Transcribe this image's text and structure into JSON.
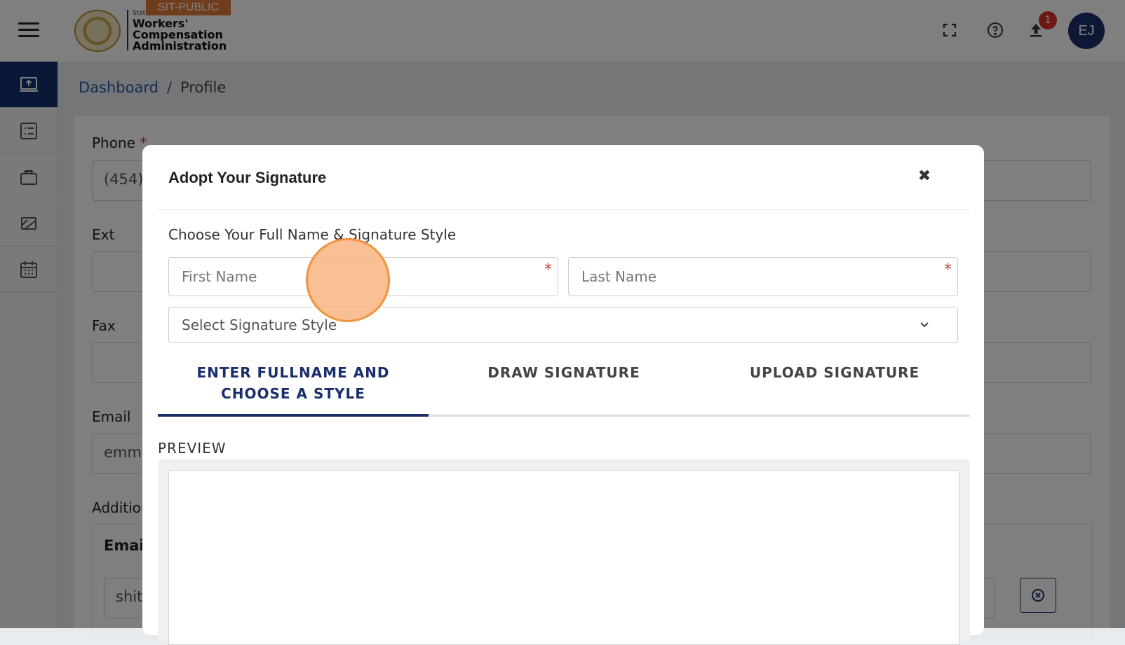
{
  "header": {
    "env_badge": "SIT-PUBLIC",
    "logo_state": "State",
    "logo_line1": "Workers'",
    "logo_line2": "Compensation",
    "logo_line3": "Administration",
    "notification_count": "1",
    "avatar_initials": "EJ"
  },
  "breadcrumb": {
    "home": "Dashboard",
    "separator": "/",
    "current": "Profile"
  },
  "profile_form": {
    "phone_label": "Phone",
    "phone_value": "(454)",
    "ext_label": "Ext",
    "fax_label": "Fax",
    "email_label": "Email",
    "email_value": "emm",
    "additional_label": "Addition",
    "email_table_header": "Emai",
    "email_row_value": "shit",
    "required_mark": "*"
  },
  "modal": {
    "title": "Adopt Your Signature",
    "close_glyph": "✖",
    "choose_label": "Choose Your Full Name & Signature Style",
    "first_name_placeholder": "First Name",
    "last_name_placeholder": "Last Name",
    "required_mark": "*",
    "style_placeholder": "Select Signature Style",
    "tabs": [
      {
        "line1": "ENTER FULLNAME AND",
        "line2": "CHOOSE A STYLE",
        "active": true
      },
      {
        "line1": "DRAW SIGNATURE",
        "line2": "",
        "active": false
      },
      {
        "line1": "UPLOAD SIGNATURE",
        "line2": "",
        "active": false
      }
    ],
    "preview_label": "PREVIEW"
  },
  "colors": {
    "primary": "#1b2e6c",
    "required": "#c0392b",
    "env_badge": "#e07b39",
    "click_marker": "#f0943e"
  }
}
